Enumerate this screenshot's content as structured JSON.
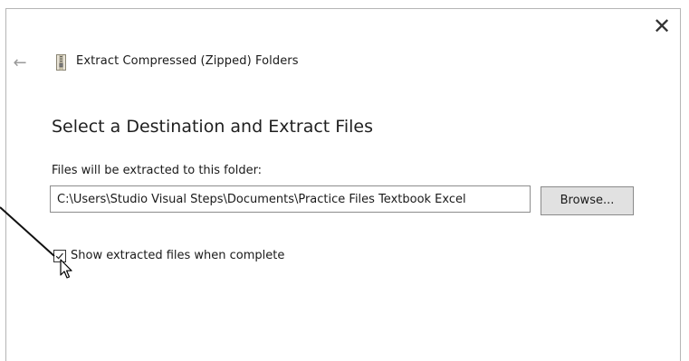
{
  "window": {
    "close_glyph": "✕",
    "back_glyph": "←",
    "title": "Extract Compressed (Zipped) Folders",
    "title_icon": "zip-folder-icon"
  },
  "page": {
    "heading": "Select a Destination and Extract Files",
    "destination_label": "Files will be extracted to this folder:",
    "destination_path": "C:\\Users\\Studio Visual Steps\\Documents\\Practice Files Textbook Excel",
    "browse_label": "Browse...",
    "show_files_label": "Show extracted files when complete",
    "show_files_checked": true
  },
  "colors": {
    "border": "#b5b5b5",
    "button_bg": "#e1e1e1",
    "text": "#1a1a1a"
  }
}
